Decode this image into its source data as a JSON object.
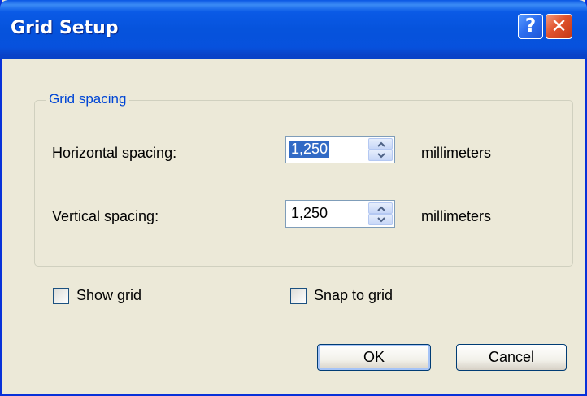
{
  "window": {
    "title": "Grid Setup",
    "help_symbol": "?",
    "close_symbol": "✕"
  },
  "grid_spacing": {
    "legend": "Grid spacing",
    "horizontal": {
      "label": "Horizontal spacing:",
      "value": "1,250",
      "unit": "millimeters",
      "selected": true
    },
    "vertical": {
      "label": "Vertical spacing:",
      "value": "1,250",
      "unit": "millimeters",
      "selected": false
    }
  },
  "options": {
    "show_grid": {
      "label": "Show grid",
      "checked": false
    },
    "snap_to_grid": {
      "label": "Snap to grid",
      "checked": false
    }
  },
  "buttons": {
    "ok": "OK",
    "cancel": "Cancel"
  },
  "colors": {
    "titlebar": "#0653dc",
    "dialog_bg": "#ece9d8",
    "legend_text": "#0046d5",
    "selection": "#316ac5"
  },
  "icons": {
    "help": "help-icon",
    "close": "close-icon",
    "spin_up": "chevron-up-icon",
    "spin_down": "chevron-down-icon"
  }
}
